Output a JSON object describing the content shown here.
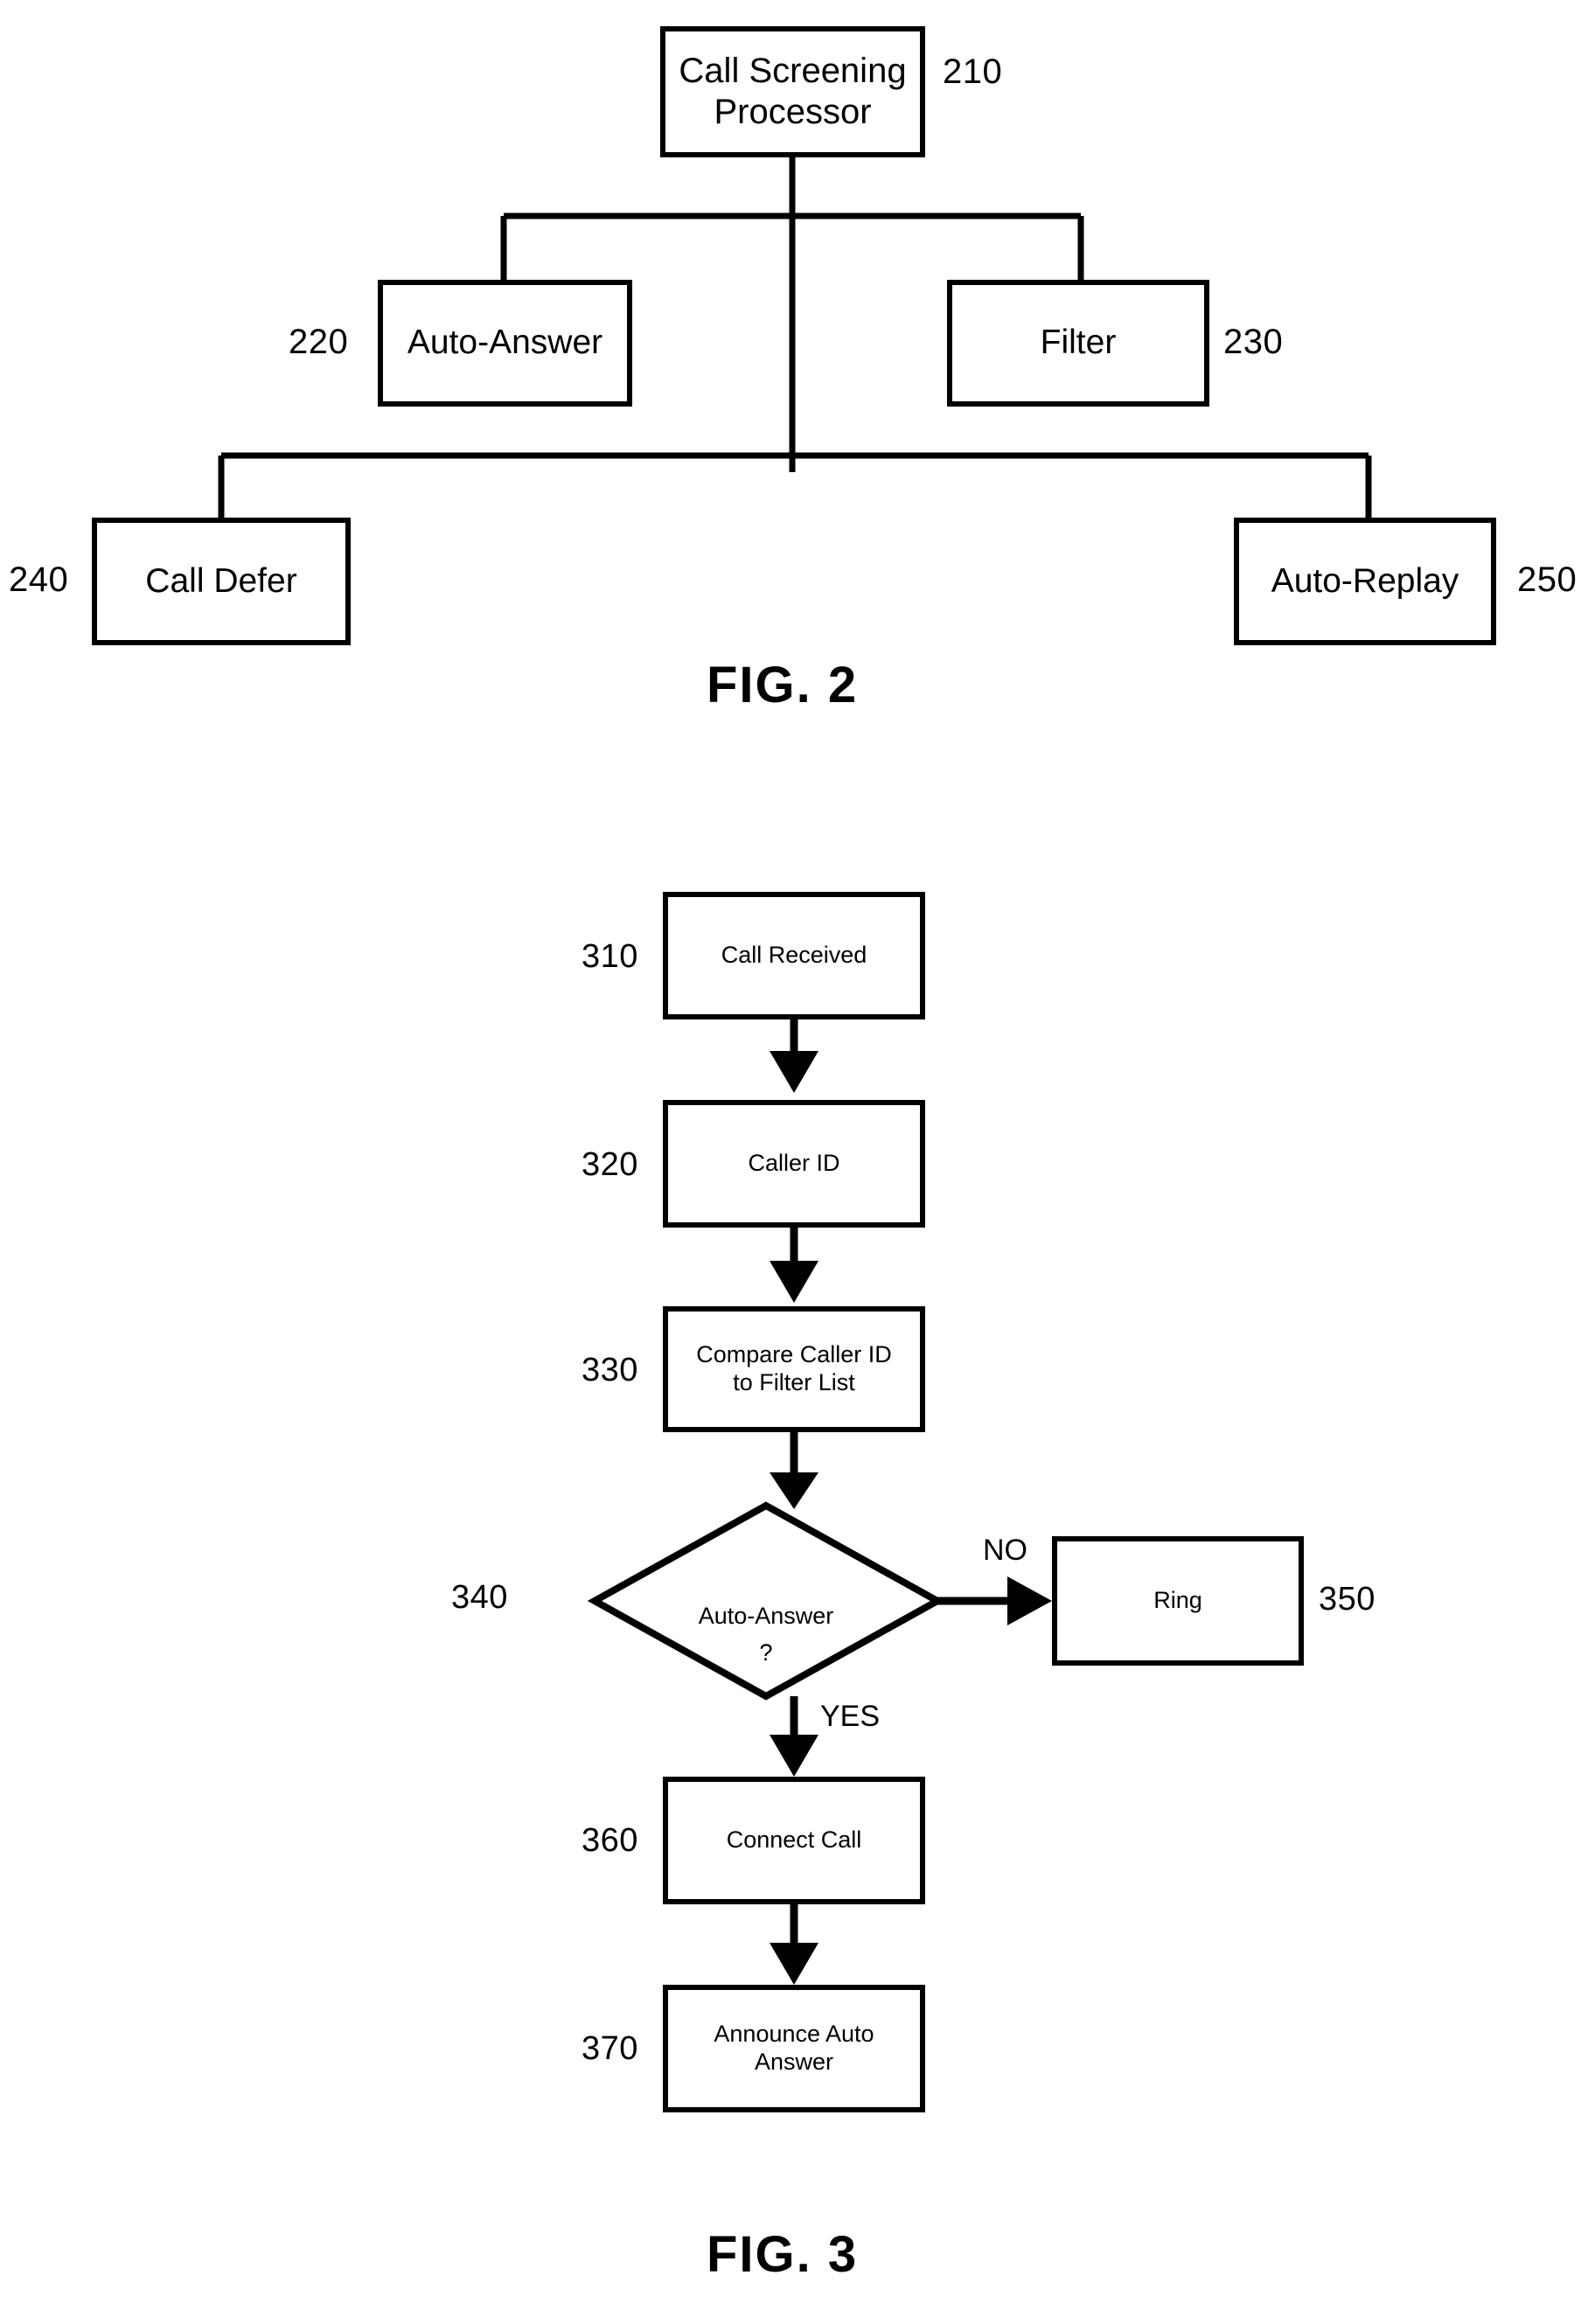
{
  "figures": [
    {
      "caption": "FIG. 2",
      "type": "block-diagram",
      "nodes": [
        {
          "ref": "210",
          "label": "Call Screening\nProcessor"
        },
        {
          "ref": "220",
          "label": "Auto-Answer"
        },
        {
          "ref": "230",
          "label": "Filter"
        },
        {
          "ref": "240",
          "label": "Call Defer"
        },
        {
          "ref": "250",
          "label": "Auto-Replay"
        }
      ]
    },
    {
      "caption": "FIG. 3",
      "type": "flowchart",
      "nodes": [
        {
          "ref": "310",
          "label": "Call Received"
        },
        {
          "ref": "320",
          "label": "Caller ID"
        },
        {
          "ref": "330",
          "label": "Compare Caller ID\nto Filter List"
        },
        {
          "ref": "340",
          "label": "Auto-Answer\n?"
        },
        {
          "ref": "350",
          "label": "Ring"
        },
        {
          "ref": "360",
          "label": "Connect Call"
        },
        {
          "ref": "370",
          "label": "Announce Auto\nAnswer"
        }
      ],
      "branch_labels": [
        {
          "id": "no",
          "text": "NO"
        },
        {
          "id": "yes",
          "text": "YES"
        }
      ]
    }
  ],
  "colors": {
    "stroke": "#000000",
    "background": "#ffffff"
  }
}
